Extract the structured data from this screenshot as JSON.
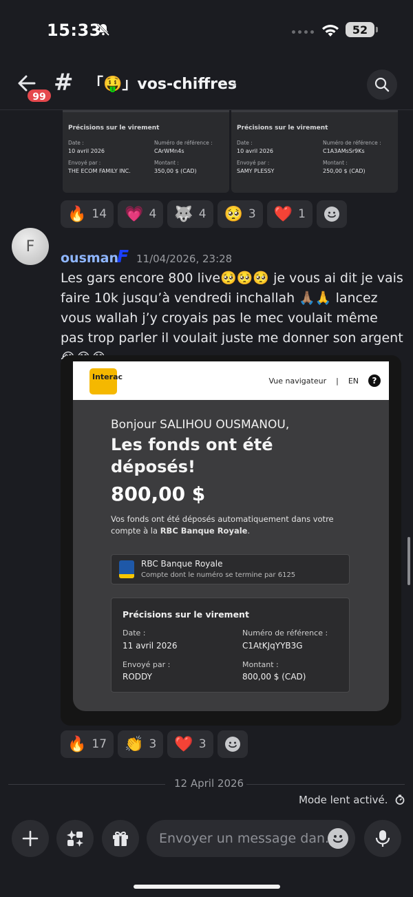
{
  "status": {
    "time": "15:33",
    "battery": "52"
  },
  "header": {
    "badge": "99",
    "channel": "「🤑」vos-chiffres"
  },
  "top_receipts": [
    {
      "title": "Précisions sur le virement",
      "date_label": "Date :",
      "date": "10 avril 2026",
      "ref_label": "Numéro de référence :",
      "ref": "CArWMn4s",
      "sender_label": "Envoyé par :",
      "sender": "THE ECOM FAMILY INC.",
      "amount_label": "Montant :",
      "amount": "350,00 $ (CAD)"
    },
    {
      "title": "Précisions sur le virement",
      "date_label": "Date :",
      "date": "10 avril 2026",
      "ref_label": "Numéro de référence :",
      "ref": "C1A3AMsSr9Ks",
      "sender_label": "Envoyé par :",
      "sender": "SAMY PLESSY",
      "amount_label": "Montant :",
      "amount": "250,00 $ (CAD)"
    }
  ],
  "reactions_top": [
    {
      "emoji": "🔥",
      "count": "14"
    },
    {
      "emoji": "💗",
      "count": "4"
    },
    {
      "emoji": "🐺",
      "count": "4"
    },
    {
      "emoji": "🥺",
      "count": "3"
    },
    {
      "emoji": "❤️",
      "count": "1"
    }
  ],
  "message": {
    "avatar_letter": "F",
    "username": "ousman",
    "tag": "F",
    "timestamp": "11/04/2026, 23:28",
    "text": "Les gars encore 800 live🥺🥺🥺 je vous ai dit je vais faire 10k jusqu’à vendredi inchallah 🙏🏽🙏 lancez vous wallah j’y croyais pas le mec voulait même pas trop parler il voulait juste me donner son argent 😂😂😂"
  },
  "interac": {
    "logo": "Interac",
    "nav_link": "Vue navigateur",
    "separator": "|",
    "lang": "EN",
    "help": "?",
    "greeting": "Bonjour SALIHOU OUSMANOU,",
    "headline": "Les fonds ont été déposés!",
    "amount": "800,00 $",
    "auto_text_1": "Vos fonds ont été déposés automatiquement dans votre compte à la ",
    "auto_text_bank": "RBC Banque Royale",
    "auto_text_2": ".",
    "bank_name": "RBC Banque Royale",
    "bank_account": "Compte dont le numéro se termine par 6125",
    "details_title": "Précisions sur le virement",
    "date_label": "Date :",
    "date": "11 avril 2026",
    "ref_label": "Numéro de référence :",
    "ref": "C1AtKJqYYB3G",
    "sender_label": "Envoyé par :",
    "sender": "RODDY",
    "amount_label": "Montant :",
    "amount_cad": "800,00 $ (CAD)"
  },
  "reactions_bottom": [
    {
      "emoji": "🔥",
      "count": "17"
    },
    {
      "emoji": "👏",
      "count": "3"
    },
    {
      "emoji": "❤️",
      "count": "3"
    }
  ],
  "date_separator": "12 April 2026",
  "slow_mode": "Mode lent activé.",
  "composer": {
    "placeholder": "Envoyer un message dan.."
  }
}
